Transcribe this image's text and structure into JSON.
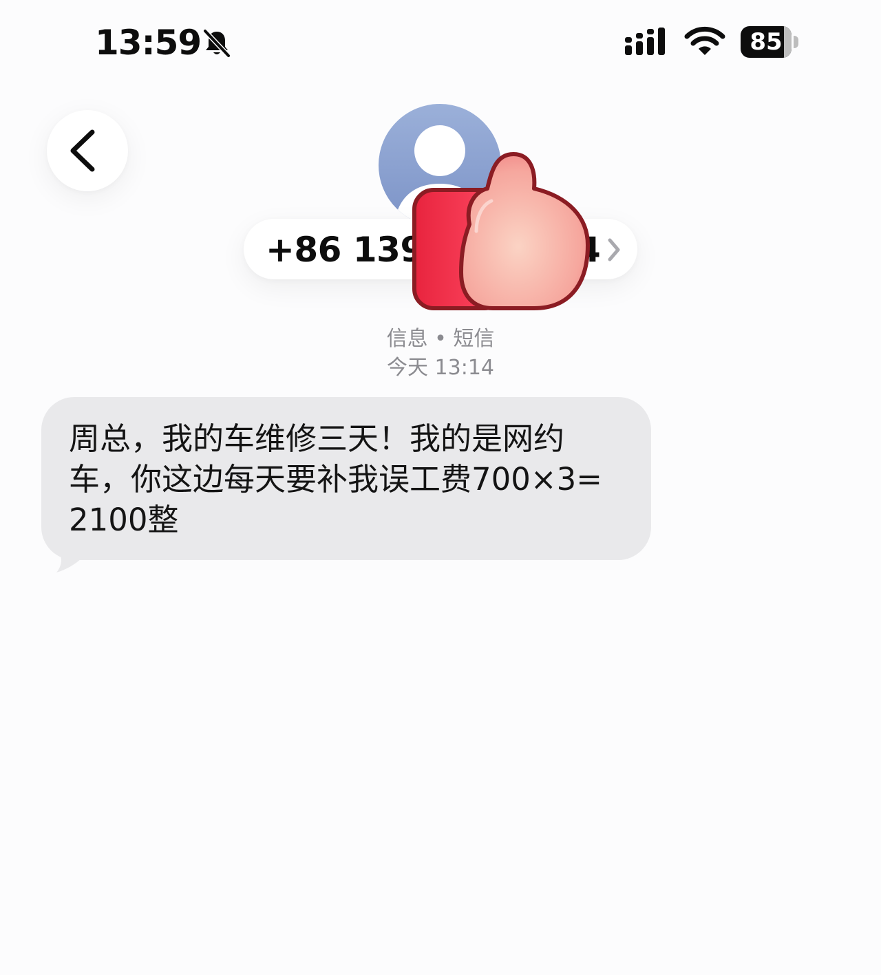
{
  "status_bar": {
    "time": "13:59",
    "battery_level": "85",
    "battery_fraction": 0.85,
    "icons": [
      "mute-icon",
      "signal-icon",
      "wifi-icon",
      "battery-icon"
    ]
  },
  "header": {
    "back_icon": "chevron-left-icon",
    "avatar": "avatar-icon",
    "contact_number_visible": "+86 139",
    "contact_number_tail": "4",
    "contact_chevron": "chevron-right-icon",
    "sticker": "thumbs-up-sticker-icon"
  },
  "meta": {
    "service": "信息 • 短信",
    "date": "今天 13:14"
  },
  "message": {
    "text": "周总，我的车维修三天！我的是网约车，你这边每天要补我误工费700×3=2100整",
    "bubble_color": "#e9e9eb"
  },
  "colors": {
    "background": "#fcfcfd",
    "secondary_text": "#8b8b90",
    "avatar": "#8aa0d0"
  }
}
